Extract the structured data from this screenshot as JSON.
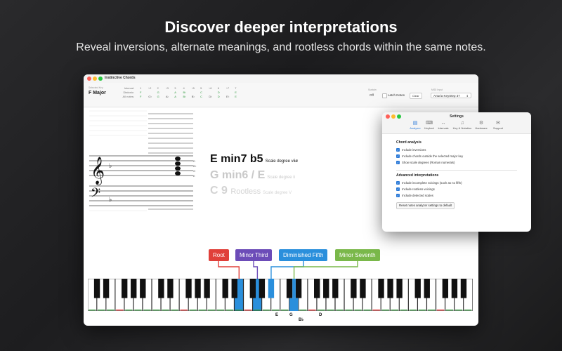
{
  "hero": {
    "title": "Discover deeper interpretations",
    "subtitle": "Reveal inversions, alternate meanings, and rootless chords within the same notes."
  },
  "window": {
    "title": "Instinctive Chords",
    "key_label": "Selected Key",
    "key_value": "F Major",
    "intervals": {
      "row_labels": [
        "Interval:",
        "Diatonic:",
        "All notes:"
      ],
      "headers": [
        "1",
        "♭2",
        "2",
        "♭3",
        "3",
        "4",
        "♭5",
        "5",
        "♭6",
        "6",
        "♭7",
        "7"
      ],
      "diatonic": [
        "F",
        "",
        "G",
        "",
        "A",
        "B♭",
        "",
        "C",
        "",
        "D",
        "",
        "E"
      ],
      "all_notes": [
        "F",
        "G♭",
        "G",
        "A♭",
        "A",
        "B♭",
        "B♭",
        "C",
        "D♭",
        "D",
        "E♭",
        "E"
      ]
    },
    "sustain_label": "Sustain",
    "sustain_value": "Off",
    "latch_label": "Latch Notes",
    "clear_label": "Clear",
    "midi_label": "MIDI Input",
    "midi_value": "Arturia KeyStep 37",
    "staff_note_labels": [
      "D",
      "B♭",
      "G",
      "E"
    ]
  },
  "chords": [
    {
      "name": "E min7 b5",
      "degree": "Scale degree viiø"
    },
    {
      "name": "G min6 / E",
      "degree": "Scale degree ii"
    },
    {
      "name": "C 9",
      "qualifier": "Rootless",
      "degree": "Scale degree V"
    }
  ],
  "interval_labels": [
    {
      "text": "Root",
      "color": "#e0403a"
    },
    {
      "text": "Minor Third",
      "color": "#6c4cb8"
    },
    {
      "text": "Diminished Fifth",
      "color": "#2a8fdc"
    },
    {
      "text": "Minor Seventh",
      "color": "#7ab84a"
    }
  ],
  "keyboard_notes": [
    "E",
    "G",
    "B♭",
    "D"
  ],
  "settings": {
    "title": "Settings",
    "tabs": [
      "Analyzer",
      "Keybed",
      "Intervals",
      "Key & Notation",
      "Hardware",
      "Support"
    ],
    "active_tab": "Analyzer",
    "section1": "Chord analysis",
    "options1": [
      "Include inversions",
      "Include chords outside the selected major key",
      "Show scale degrees (Roman numerals)"
    ],
    "section2": "Advanced interpretations",
    "options2": [
      "Include incomplete voicings (such as no fifth)",
      "Include rootless voicings",
      "Include detected scales"
    ],
    "reset_label": "Reset notes analyzer settings to default"
  }
}
